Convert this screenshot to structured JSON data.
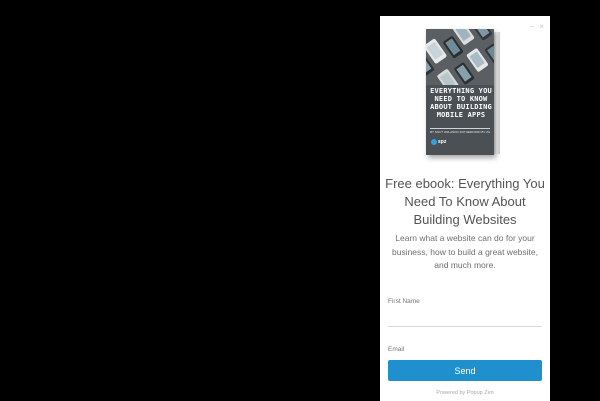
{
  "popup": {
    "window_controls": {
      "minimize_glyph": "–",
      "close_glyph": "×"
    },
    "book": {
      "title": "EVERYTHING YOU NEED TO KNOW ABOUT BUILDING MOBILE APPS",
      "subtitle": "BY SOUT ORLANDO RUTHERFORD BY ZAPPYBUILDS",
      "logo_text": "spz",
      "cover_color": "#4b5054",
      "accent_color": "#35a1dc"
    },
    "headline": "Free ebook: Everything You Need To Know About Building Websites",
    "description": "Learn what a website can do for your business, how to build a great website, and much more.",
    "form": {
      "first_name_label": "First Name",
      "first_name_value": "",
      "email_label": "Email",
      "email_value": "",
      "send_label": "Send",
      "button_color": "#1f90cd"
    },
    "powered_by": "Powered by Popup Zen"
  }
}
